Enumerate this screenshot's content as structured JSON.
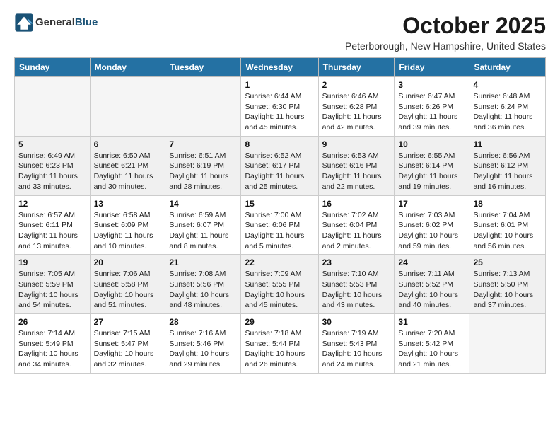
{
  "logo": {
    "general": "General",
    "blue": "Blue"
  },
  "title": "October 2025",
  "location": "Peterborough, New Hampshire, United States",
  "days_of_week": [
    "Sunday",
    "Monday",
    "Tuesday",
    "Wednesday",
    "Thursday",
    "Friday",
    "Saturday"
  ],
  "weeks": [
    [
      {
        "day": "",
        "sunrise": "",
        "sunset": "",
        "daylight": "",
        "empty": true
      },
      {
        "day": "",
        "sunrise": "",
        "sunset": "",
        "daylight": "",
        "empty": true
      },
      {
        "day": "",
        "sunrise": "",
        "sunset": "",
        "daylight": "",
        "empty": true
      },
      {
        "day": "1",
        "sunrise": "Sunrise: 6:44 AM",
        "sunset": "Sunset: 6:30 PM",
        "daylight": "Daylight: 11 hours and 45 minutes."
      },
      {
        "day": "2",
        "sunrise": "Sunrise: 6:46 AM",
        "sunset": "Sunset: 6:28 PM",
        "daylight": "Daylight: 11 hours and 42 minutes."
      },
      {
        "day": "3",
        "sunrise": "Sunrise: 6:47 AM",
        "sunset": "Sunset: 6:26 PM",
        "daylight": "Daylight: 11 hours and 39 minutes."
      },
      {
        "day": "4",
        "sunrise": "Sunrise: 6:48 AM",
        "sunset": "Sunset: 6:24 PM",
        "daylight": "Daylight: 11 hours and 36 minutes."
      }
    ],
    [
      {
        "day": "5",
        "sunrise": "Sunrise: 6:49 AM",
        "sunset": "Sunset: 6:23 PM",
        "daylight": "Daylight: 11 hours and 33 minutes."
      },
      {
        "day": "6",
        "sunrise": "Sunrise: 6:50 AM",
        "sunset": "Sunset: 6:21 PM",
        "daylight": "Daylight: 11 hours and 30 minutes."
      },
      {
        "day": "7",
        "sunrise": "Sunrise: 6:51 AM",
        "sunset": "Sunset: 6:19 PM",
        "daylight": "Daylight: 11 hours and 28 minutes."
      },
      {
        "day": "8",
        "sunrise": "Sunrise: 6:52 AM",
        "sunset": "Sunset: 6:17 PM",
        "daylight": "Daylight: 11 hours and 25 minutes."
      },
      {
        "day": "9",
        "sunrise": "Sunrise: 6:53 AM",
        "sunset": "Sunset: 6:16 PM",
        "daylight": "Daylight: 11 hours and 22 minutes."
      },
      {
        "day": "10",
        "sunrise": "Sunrise: 6:55 AM",
        "sunset": "Sunset: 6:14 PM",
        "daylight": "Daylight: 11 hours and 19 minutes."
      },
      {
        "day": "11",
        "sunrise": "Sunrise: 6:56 AM",
        "sunset": "Sunset: 6:12 PM",
        "daylight": "Daylight: 11 hours and 16 minutes."
      }
    ],
    [
      {
        "day": "12",
        "sunrise": "Sunrise: 6:57 AM",
        "sunset": "Sunset: 6:11 PM",
        "daylight": "Daylight: 11 hours and 13 minutes."
      },
      {
        "day": "13",
        "sunrise": "Sunrise: 6:58 AM",
        "sunset": "Sunset: 6:09 PM",
        "daylight": "Daylight: 11 hours and 10 minutes."
      },
      {
        "day": "14",
        "sunrise": "Sunrise: 6:59 AM",
        "sunset": "Sunset: 6:07 PM",
        "daylight": "Daylight: 11 hours and 8 minutes."
      },
      {
        "day": "15",
        "sunrise": "Sunrise: 7:00 AM",
        "sunset": "Sunset: 6:06 PM",
        "daylight": "Daylight: 11 hours and 5 minutes."
      },
      {
        "day": "16",
        "sunrise": "Sunrise: 7:02 AM",
        "sunset": "Sunset: 6:04 PM",
        "daylight": "Daylight: 11 hours and 2 minutes."
      },
      {
        "day": "17",
        "sunrise": "Sunrise: 7:03 AM",
        "sunset": "Sunset: 6:02 PM",
        "daylight": "Daylight: 10 hours and 59 minutes."
      },
      {
        "day": "18",
        "sunrise": "Sunrise: 7:04 AM",
        "sunset": "Sunset: 6:01 PM",
        "daylight": "Daylight: 10 hours and 56 minutes."
      }
    ],
    [
      {
        "day": "19",
        "sunrise": "Sunrise: 7:05 AM",
        "sunset": "Sunset: 5:59 PM",
        "daylight": "Daylight: 10 hours and 54 minutes."
      },
      {
        "day": "20",
        "sunrise": "Sunrise: 7:06 AM",
        "sunset": "Sunset: 5:58 PM",
        "daylight": "Daylight: 10 hours and 51 minutes."
      },
      {
        "day": "21",
        "sunrise": "Sunrise: 7:08 AM",
        "sunset": "Sunset: 5:56 PM",
        "daylight": "Daylight: 10 hours and 48 minutes."
      },
      {
        "day": "22",
        "sunrise": "Sunrise: 7:09 AM",
        "sunset": "Sunset: 5:55 PM",
        "daylight": "Daylight: 10 hours and 45 minutes."
      },
      {
        "day": "23",
        "sunrise": "Sunrise: 7:10 AM",
        "sunset": "Sunset: 5:53 PM",
        "daylight": "Daylight: 10 hours and 43 minutes."
      },
      {
        "day": "24",
        "sunrise": "Sunrise: 7:11 AM",
        "sunset": "Sunset: 5:52 PM",
        "daylight": "Daylight: 10 hours and 40 minutes."
      },
      {
        "day": "25",
        "sunrise": "Sunrise: 7:13 AM",
        "sunset": "Sunset: 5:50 PM",
        "daylight": "Daylight: 10 hours and 37 minutes."
      }
    ],
    [
      {
        "day": "26",
        "sunrise": "Sunrise: 7:14 AM",
        "sunset": "Sunset: 5:49 PM",
        "daylight": "Daylight: 10 hours and 34 minutes."
      },
      {
        "day": "27",
        "sunrise": "Sunrise: 7:15 AM",
        "sunset": "Sunset: 5:47 PM",
        "daylight": "Daylight: 10 hours and 32 minutes."
      },
      {
        "day": "28",
        "sunrise": "Sunrise: 7:16 AM",
        "sunset": "Sunset: 5:46 PM",
        "daylight": "Daylight: 10 hours and 29 minutes."
      },
      {
        "day": "29",
        "sunrise": "Sunrise: 7:18 AM",
        "sunset": "Sunset: 5:44 PM",
        "daylight": "Daylight: 10 hours and 26 minutes."
      },
      {
        "day": "30",
        "sunrise": "Sunrise: 7:19 AM",
        "sunset": "Sunset: 5:43 PM",
        "daylight": "Daylight: 10 hours and 24 minutes."
      },
      {
        "day": "31",
        "sunrise": "Sunrise: 7:20 AM",
        "sunset": "Sunset: 5:42 PM",
        "daylight": "Daylight: 10 hours and 21 minutes."
      },
      {
        "day": "",
        "sunrise": "",
        "sunset": "",
        "daylight": "",
        "empty": true
      }
    ]
  ]
}
